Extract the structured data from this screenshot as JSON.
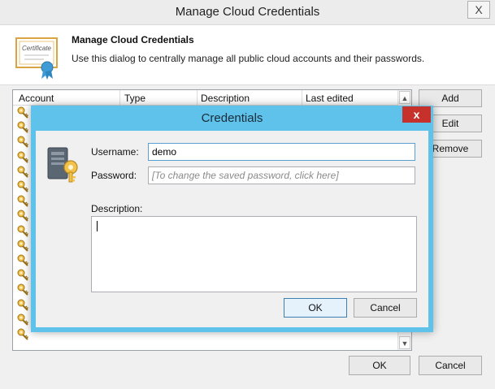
{
  "outer": {
    "title": "Manage Cloud Credentials",
    "close_glyph": "X",
    "header_title": "Manage Cloud Credentials",
    "header_desc": "Use this dialog to centrally manage all public cloud accounts and their passwords.",
    "certificate_label": "Certificate",
    "columns": [
      "Account",
      "Type",
      "Description",
      "Last edited"
    ],
    "row_count": 16,
    "buttons": {
      "add": "Add",
      "edit": "Edit",
      "remove": "Remove",
      "ok": "OK",
      "cancel": "Cancel"
    }
  },
  "credentials": {
    "title": "Credentials",
    "close_glyph": "x",
    "username_label": "Username:",
    "username_value": "demo",
    "password_label": "Password:",
    "password_placeholder": "[To change the saved password, click here]",
    "description_label": "Description:",
    "description_value": "",
    "ok": "OK",
    "cancel": "Cancel"
  },
  "icons": [
    "certificate-icon",
    "key-icon",
    "server-key-icon",
    "scroll-up-icon",
    "scroll-down-icon",
    "close-icon"
  ],
  "colors": {
    "dialog_frame": "#5ec2ea",
    "close_red": "#c7312b",
    "focus_border": "#3c7fb1"
  }
}
